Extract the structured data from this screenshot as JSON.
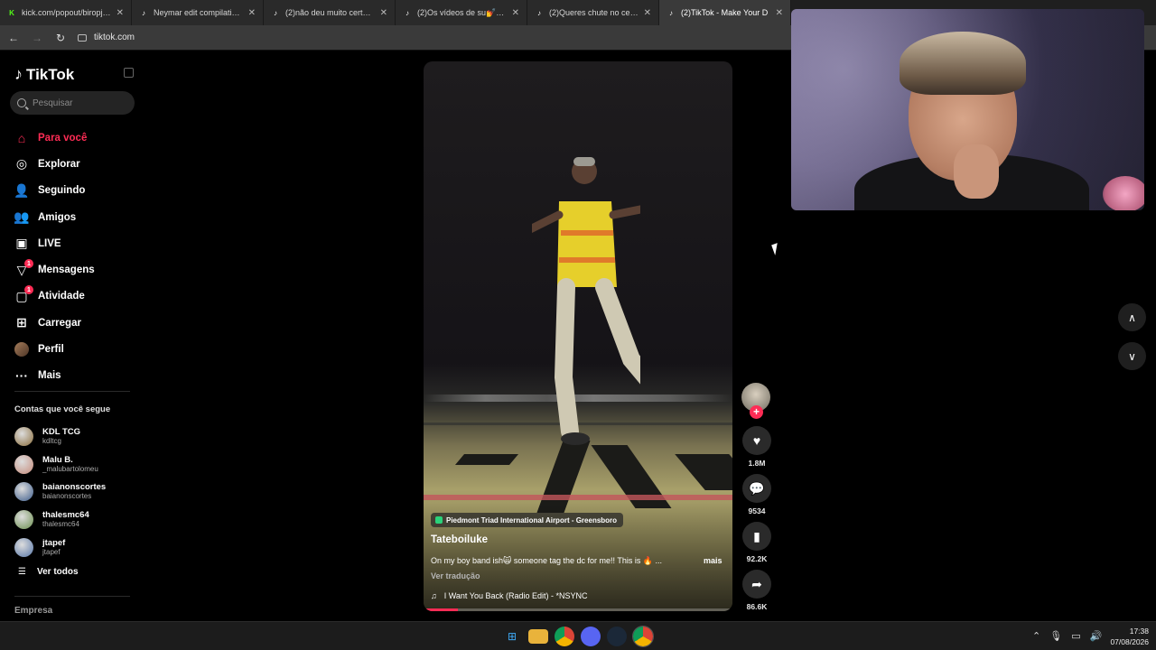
{
  "browser": {
    "tabs": [
      {
        "title": "kick.com/popout/biropjl/ch",
        "favicon": "K",
        "color": "#53fc18"
      },
      {
        "title": "Neymar edit compilation —",
        "favicon": "♪",
        "color": "#ffffff"
      },
      {
        "title": "(2)não deu muito certo 🤔",
        "favicon": "♪",
        "color": "#ffffff"
      },
      {
        "title": "(2)Os vídeos de su💅 🏆 ☺",
        "favicon": "♪",
        "color": "#ffffff"
      },
      {
        "title": "(2)Queres chute no celular",
        "favicon": "♪",
        "color": "#ffffff"
      },
      {
        "title": "(2)TikTok - Make Your D",
        "favicon": "♪",
        "color": "#ffffff"
      }
    ],
    "url": "tiktok.com"
  },
  "sidebar": {
    "logo": "TikTok",
    "search_placeholder": "Pesquisar",
    "menu": [
      {
        "label": "Para você",
        "icon": "home-icon",
        "active": true
      },
      {
        "label": "Explorar",
        "icon": "compass-icon"
      },
      {
        "label": "Seguindo",
        "icon": "following-icon"
      },
      {
        "label": "Amigos",
        "icon": "friends-icon"
      },
      {
        "label": "LIVE",
        "icon": "live-icon"
      },
      {
        "label": "Mensagens",
        "icon": "messages-icon",
        "badge": "1"
      },
      {
        "label": "Atividade",
        "icon": "activity-icon",
        "badge": "1"
      },
      {
        "label": "Carregar",
        "icon": "upload-icon"
      },
      {
        "label": "Perfil",
        "icon": "profile-avatar"
      },
      {
        "label": "Mais",
        "icon": "more-icon"
      }
    ],
    "following_title": "Contas que você segue",
    "accounts": [
      {
        "name": "KDL TCG",
        "handle": "kdltcg",
        "color": "#8a6d3b"
      },
      {
        "name": "Malu B.",
        "handle": "_malubartolomeu",
        "color": "#c58a7a"
      },
      {
        "name": "baianonscortes",
        "handle": "baianonscortes",
        "color": "#3b5b8a"
      },
      {
        "name": "thalesmc64",
        "handle": "thalesmc64",
        "color": "#6b8f4e"
      },
      {
        "name": "jtapef",
        "handle": "jtapef",
        "color": "#5676a8"
      }
    ],
    "see_all": "Ver todos",
    "footer": "Empresa"
  },
  "video": {
    "location": "Piedmont Triad International Airport - Greensboro",
    "author": "Tateboiluke",
    "caption": "On my boy band ish🙀 someone tag the dc for me!! This is 🔥 ...",
    "more": "mais",
    "translate": "Ver tradução",
    "music": "I Want You Back (Radio Edit) - *NSYNC",
    "progress": 0.11
  },
  "actions": {
    "likes": "1.8M",
    "comments": "9534",
    "saves": "92.2K",
    "shares": "86.6K"
  },
  "taskbar": {
    "time": "17:38",
    "date": "07/08/2026"
  }
}
